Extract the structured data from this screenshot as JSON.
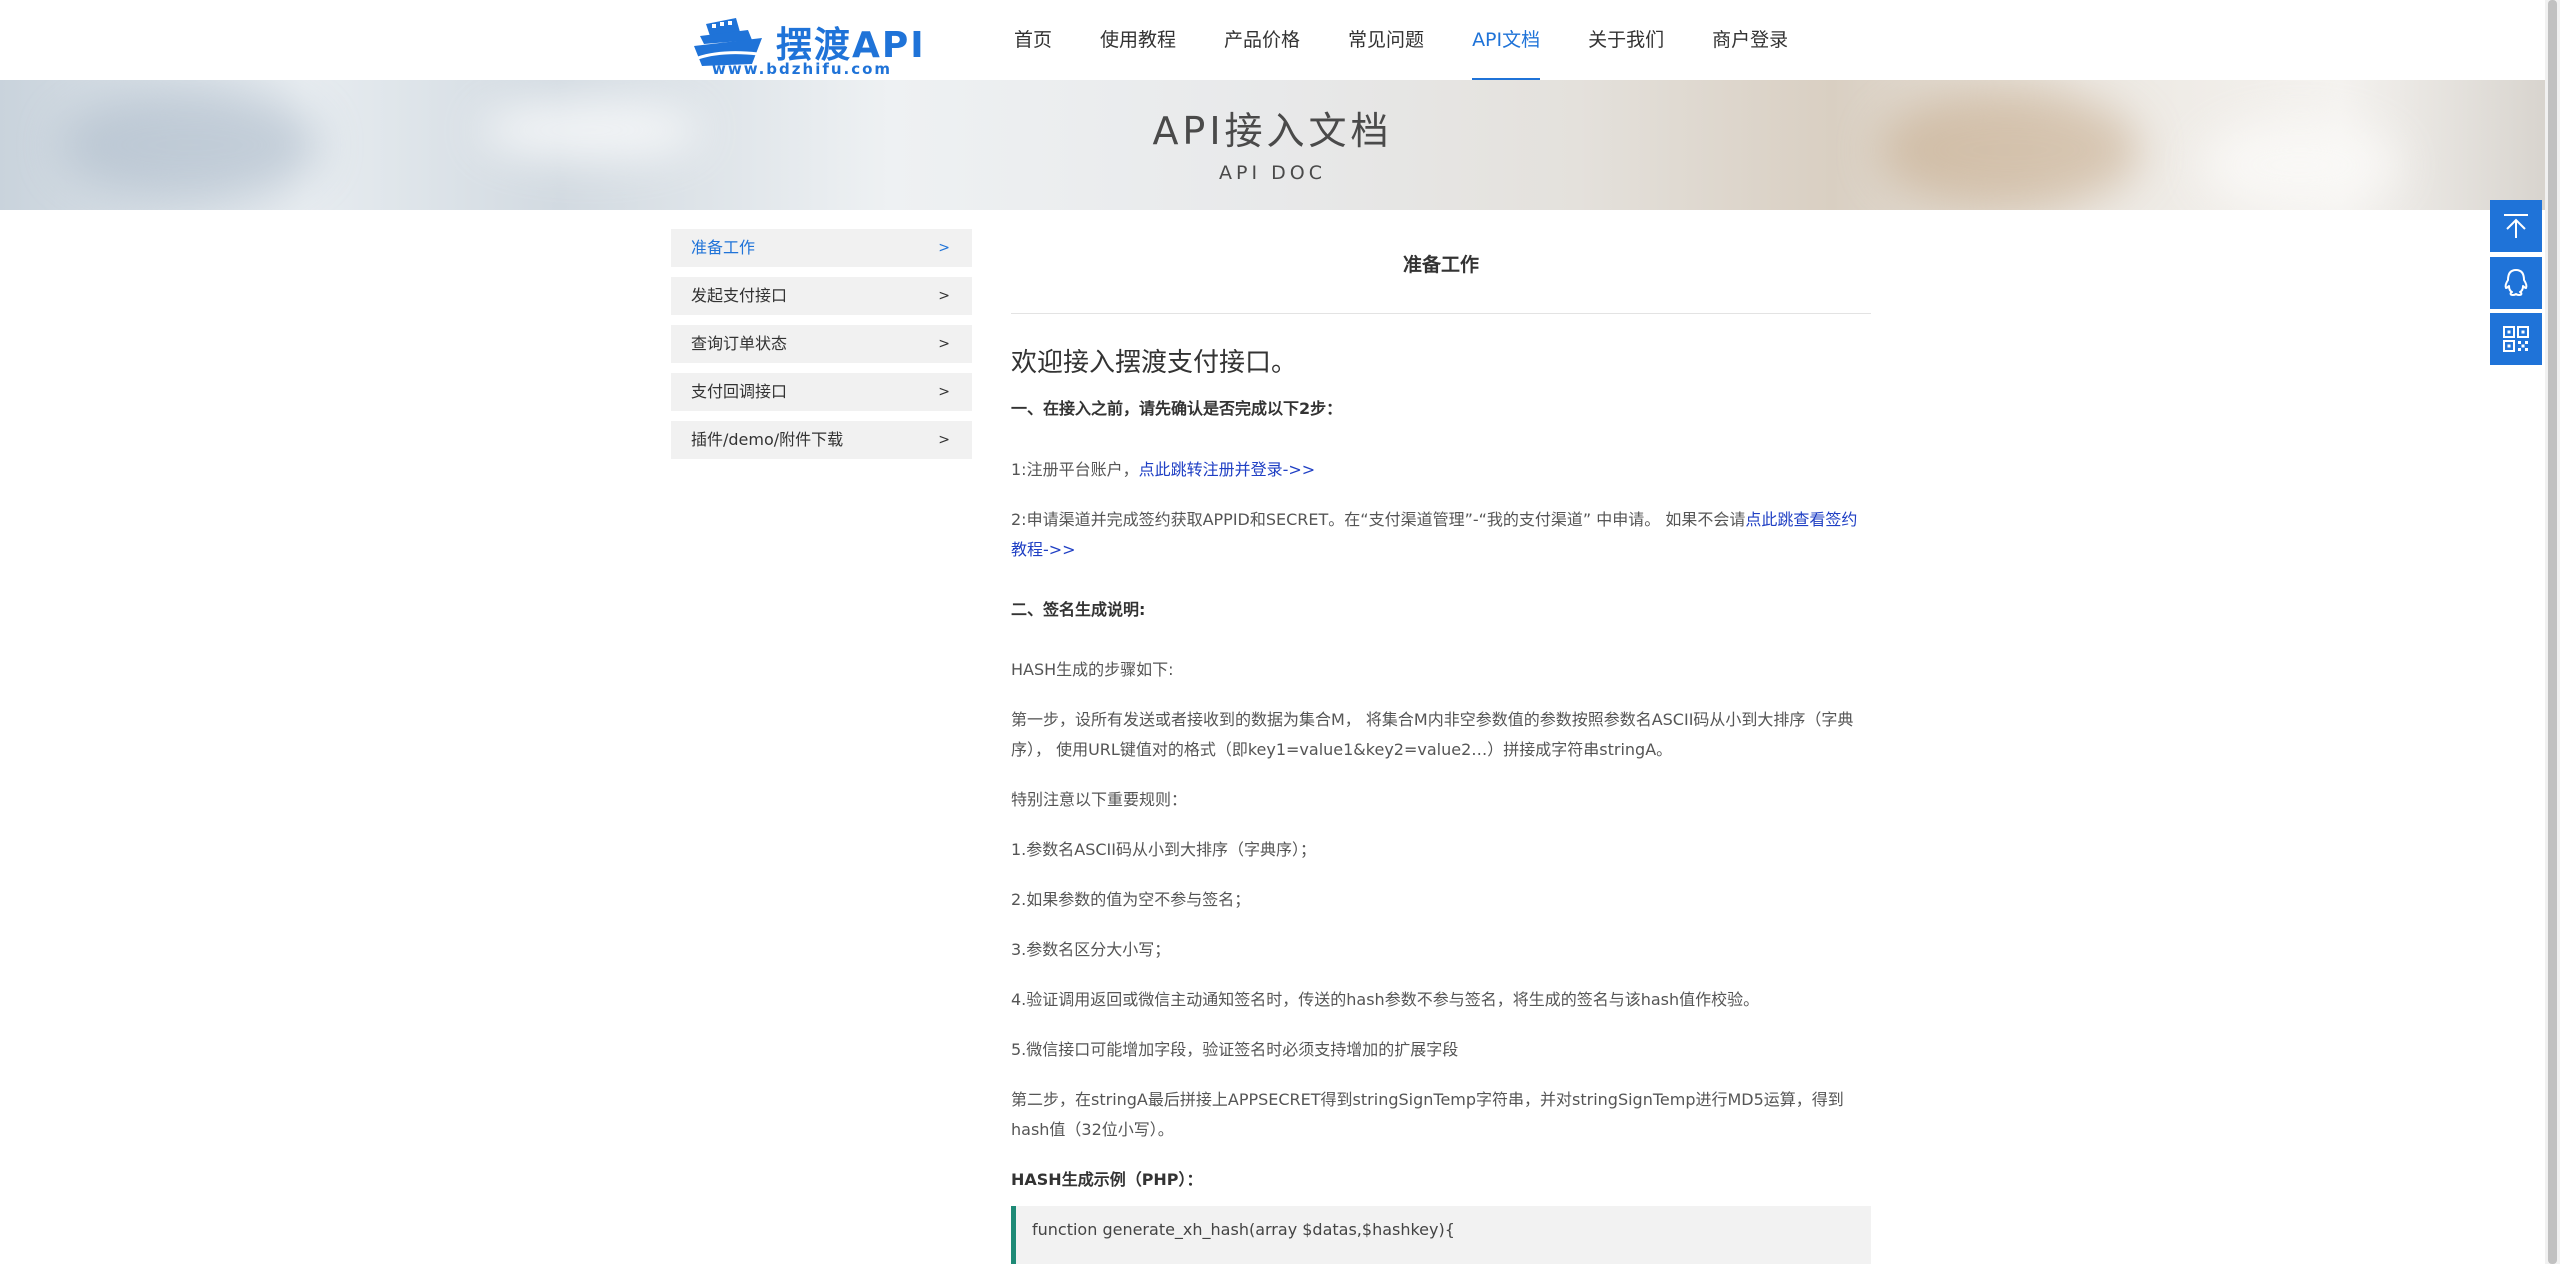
{
  "logo": {
    "title": "摆渡API",
    "url": "www.bdzhifu.com"
  },
  "nav": {
    "items": [
      {
        "label": "首页",
        "active": false
      },
      {
        "label": "使用教程",
        "active": false
      },
      {
        "label": "产品价格",
        "active": false
      },
      {
        "label": "常见问题",
        "active": false
      },
      {
        "label": "API文档",
        "active": true
      },
      {
        "label": "关于我们",
        "active": false
      },
      {
        "label": "商户登录",
        "active": false
      }
    ]
  },
  "banner": {
    "title": "API接入文档",
    "subtitle": "API DOC"
  },
  "sidebar": {
    "arrow": ">",
    "items": [
      {
        "label": "准备工作",
        "active": true
      },
      {
        "label": "发起支付接口",
        "active": false
      },
      {
        "label": "查询订单状态",
        "active": false
      },
      {
        "label": "支付回调接口",
        "active": false
      },
      {
        "label": "插件/demo/附件下载",
        "active": false
      }
    ]
  },
  "content": {
    "title": "准备工作",
    "welcome": "欢迎接入摆渡支付接口。",
    "section1": "一、在接入之前，请先确认是否完成以下2步：",
    "step1_text": "1:注册平台账户，",
    "step1_link": "点此跳转注册并登录->>",
    "step2_text": "2:申请渠道并完成签约获取APPID和SECRET。在“支付渠道管理”-“我的支付渠道” 中申请。 如果不会请",
    "step2_link": "点此跳查看签约教程->>",
    "section2": "二、签名生成说明:",
    "hash_intro": "HASH生成的步骤如下:",
    "step_one": "第一步，设所有发送或者接收到的数据为集合M， 将集合M内非空参数值的参数按照参数名ASCII码从小到大排序（字典序）， 使用URL键值对的格式（即key1=value1&key2=value2…）拼接成字符串stringA。",
    "rules_title": "特别注意以下重要规则：",
    "rule1": "1.参数名ASCII码从小到大排序（字典序）；",
    "rule2": "2.如果参数的值为空不参与签名；",
    "rule3": "3.参数名区分大小写；",
    "rule4": "4.验证调用返回或微信主动通知签名时，传送的hash参数不参与签名，将生成的签名与该hash值作校验。",
    "rule5": "5.微信接口可能增加字段，验证签名时必须支持增加的扩展字段",
    "step_two": "第二步，在stringA最后拼接上APPSECRET得到stringSignTemp字符串，并对stringSignTemp进行MD5运算，得到hash值（32位小写）。",
    "example_title": "HASH生成示例（PHP）：",
    "code_line": "function generate_xh_hash(array $datas,$hashkey){"
  },
  "float_buttons": [
    "back-to-top-icon",
    "qq-icon",
    "qrcode-icon"
  ],
  "colors": {
    "brand": "#1f73d8",
    "link": "#1f3fc4",
    "code_border": "#1e8a76"
  }
}
